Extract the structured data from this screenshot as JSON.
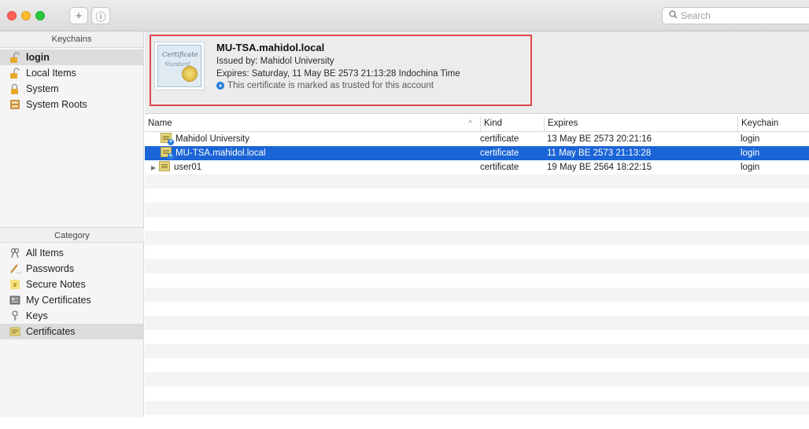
{
  "toolbar": {
    "add_icon": "+",
    "info_icon": "ⓘ",
    "search_placeholder": "Search"
  },
  "sidebar": {
    "keychains_header": "Keychains",
    "keychains": [
      {
        "label": "login",
        "icon": "unlocked-lock-icon",
        "selected": true
      },
      {
        "label": "Local Items",
        "icon": "unlocked-lock-icon"
      },
      {
        "label": "System",
        "icon": "locked-lock-icon"
      },
      {
        "label": "System Roots",
        "icon": "cabinet-icon"
      }
    ],
    "category_header": "Category",
    "categories": [
      {
        "label": "All Items",
        "icon": "keys-icon"
      },
      {
        "label": "Passwords",
        "icon": "pencil-icon"
      },
      {
        "label": "Secure Notes",
        "icon": "note-icon"
      },
      {
        "label": "My Certificates",
        "icon": "id-card-icon"
      },
      {
        "label": "Keys",
        "icon": "key-icon"
      },
      {
        "label": "Certificates",
        "icon": "certificate-icon",
        "selected": true
      }
    ]
  },
  "detail": {
    "certificate_art_line1": "Certificate",
    "certificate_art_line2": "Standard",
    "title": "MU-TSA.mahidol.local",
    "issued_by": "Issued by: Mahidol University",
    "expires": "Expires: Saturday, 11 May BE 2573 21:13:28 Indochina Time",
    "trust": "This certificate is marked as trusted for this account",
    "trust_icon": "plus-circle-icon"
  },
  "table": {
    "columns": {
      "name": "Name",
      "sort_arrow": "^",
      "kind": "Kind",
      "expires": "Expires",
      "keychain": "Keychain"
    },
    "rows": [
      {
        "name": "Mahidol University",
        "kind": "certificate",
        "expires": "13 May BE 2573 20:21:16",
        "keychain": "login"
      },
      {
        "name": "MU-TSA.mahidol.local",
        "kind": "certificate",
        "expires": "11 May BE 2573 21:13:28",
        "keychain": "login",
        "selected": true
      },
      {
        "name": "user01",
        "kind": "certificate",
        "expires": "19 May BE 2564 18:22:15",
        "keychain": "login",
        "expandable": true
      }
    ]
  },
  "colors": {
    "selection": "#1a64d6",
    "highlight_border": "#e0464c"
  }
}
